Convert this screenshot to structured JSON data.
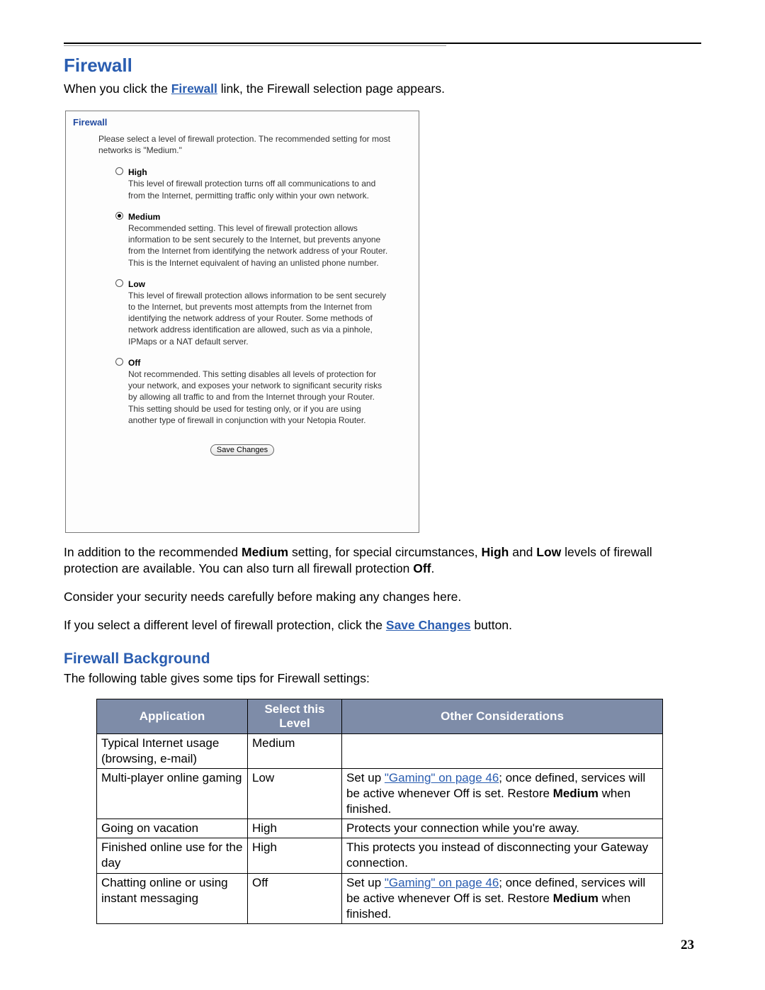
{
  "page_number": "23",
  "headings": {
    "firewall": "Firewall",
    "background": "Firewall Background"
  },
  "intro": {
    "before_link": "When you click the ",
    "link_text": "Firewall",
    "after_link": " link, the Firewall selection page appears."
  },
  "panel": {
    "title": "Firewall",
    "intro": "Please select a level of firewall protection. The recommended setting for most networks is \"Medium.\"",
    "options": {
      "high": {
        "label": "High",
        "desc": "This level of firewall protection turns off all communications to and from the Internet, permitting traffic only within your own network.",
        "selected": false
      },
      "medium": {
        "label": "Medium",
        "desc": "Recommended setting. This level of firewall protection allows information to be sent securely to the Internet, but prevents anyone from the Internet from identifying the network address of your Router. This is the Internet equivalent of having an unlisted phone number.",
        "selected": true
      },
      "low": {
        "label": "Low",
        "desc": "This level of firewall protection allows information to be sent securely to the Internet, but prevents most attempts from the Internet from identifying the network address of your Router. Some methods of network address identification are allowed, such as via a pinhole, IPMaps or a NAT default server.",
        "selected": false
      },
      "off": {
        "label": "Off",
        "desc": "Not recommended. This setting disables all levels of protection for your network, and exposes your network to significant security risks by allowing all traffic to and from the Internet through your Router. This setting should be used for testing only, or if you are using another type of firewall in conjunction with your Netopia Router.",
        "selected": false
      }
    },
    "save_button": "Save Changes"
  },
  "paragraphs": {
    "p1_a": "In addition to the recommended ",
    "p1_b": "Medium",
    "p1_c": " setting, for special circumstances, ",
    "p1_d": "High",
    "p1_e": " and ",
    "p1_f": "Low",
    "p1_g": " levels of firewall protection are available. You can also turn all firewall protection ",
    "p1_h": "Off",
    "p1_i": ".",
    "p2": "Consider your security needs carefully before making any changes here.",
    "p3_a": "If you select a different level of firewall protection, click the ",
    "p3_link": "Save Changes",
    "p3_b": " button.",
    "p4": "The following table gives some tips for Firewall settings:"
  },
  "table": {
    "headers": {
      "application": "Application",
      "level": "Select this Level",
      "other": "Other Considerations"
    },
    "rows": [
      {
        "application": "Typical Internet usage (browsing, e-mail)",
        "level": "Medium",
        "other_plain": "",
        "other_segments": []
      },
      {
        "application": "Multi-player online gaming",
        "level": "Low",
        "other_segments": [
          {
            "t": "text",
            "v": "Set up "
          },
          {
            "t": "link",
            "v": "\"Gaming\" on page 46"
          },
          {
            "t": "text",
            "v": "; once defined, services will be active whenever Off is set. Restore "
          },
          {
            "t": "bold",
            "v": "Medium"
          },
          {
            "t": "text",
            "v": " when finished."
          }
        ]
      },
      {
        "application": "Going on vacation",
        "level": "High",
        "other_segments": [
          {
            "t": "text",
            "v": "Protects your connection while you're away."
          }
        ]
      },
      {
        "application": "Finished online use for the day",
        "level": "High",
        "other_segments": [
          {
            "t": "text",
            "v": "This protects you instead of disconnecting your Gateway connection."
          }
        ]
      },
      {
        "application": "Chatting online or using instant messaging",
        "level": "Off",
        "other_segments": [
          {
            "t": "text",
            "v": "Set up "
          },
          {
            "t": "link",
            "v": "\"Gaming\" on page 46"
          },
          {
            "t": "text",
            "v": "; once defined, services will be active whenever Off is set. Restore "
          },
          {
            "t": "bold",
            "v": "Medium"
          },
          {
            "t": "text",
            "v": " when finished."
          }
        ]
      }
    ]
  }
}
